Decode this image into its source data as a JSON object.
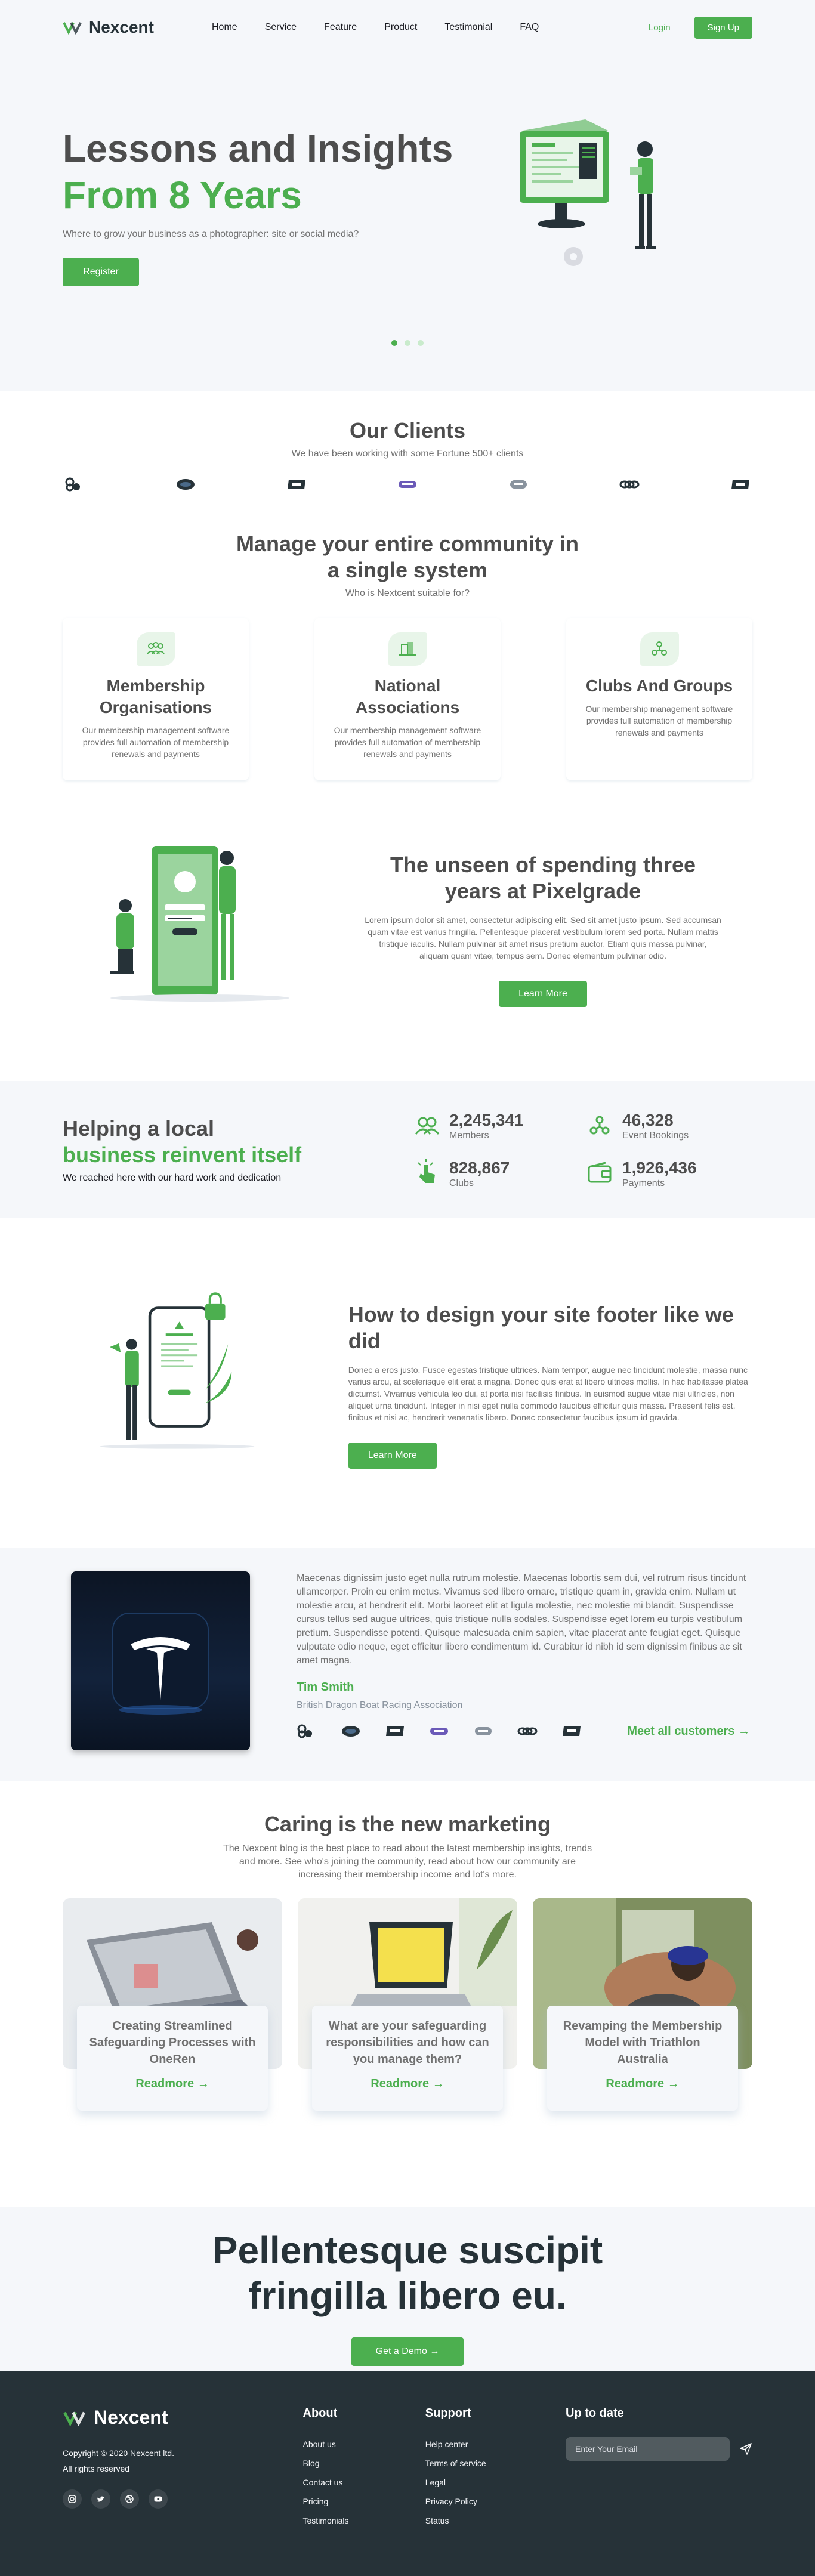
{
  "nav": {
    "brand": "Nexcent",
    "links": [
      "Home",
      "Service",
      "Feature",
      "Product",
      "Testimonial",
      "FAQ"
    ],
    "login": "Login",
    "signup": "Sign Up"
  },
  "hero": {
    "line1": "Lessons and Insights",
    "line2": "From 8 Years",
    "subtitle": "Where to grow your business as a photographer: site or social media?",
    "cta": "Register",
    "slides": 3,
    "active_slide": 1
  },
  "clients": {
    "title": "Our Clients",
    "subtitle": "We have been working with some Fortune 500+ clients",
    "logos": [
      "client-logo-1",
      "client-logo-2",
      "client-logo-3",
      "client-logo-4",
      "client-logo-5",
      "client-logo-6",
      "client-logo-7"
    ]
  },
  "community": {
    "title": "Manage your entire community in a single system",
    "subtitle": "Who is Nextcent suitable for?",
    "cards": [
      {
        "title": "Membership Organisations",
        "text": "Our membership management software provides full automation of membership renewals and payments",
        "icon": "members-icon"
      },
      {
        "title": "National Associations",
        "text": "Our membership management software provides full automation of membership renewals and payments",
        "icon": "building-icon"
      },
      {
        "title": "Clubs And Groups",
        "text": "Our membership management software provides full automation of membership renewals and payments",
        "icon": "hand-icon"
      }
    ]
  },
  "feature1": {
    "title": "The unseen of spending three years at Pixelgrade",
    "text": "Lorem ipsum dolor sit amet, consectetur adipiscing elit. Sed sit amet justo ipsum. Sed accumsan quam vitae est varius fringilla. Pellentesque placerat vestibulum lorem sed porta. Nullam mattis tristique iaculis. Nullam pulvinar sit amet risus pretium auctor. Etiam quis massa pulvinar, aliquam quam vitae, tempus sem. Donec elementum pulvinar odio.",
    "cta": "Learn More"
  },
  "stats": {
    "line1": "Helping a local",
    "line2": "business reinvent itself",
    "subtitle": "We reached here with our hard work and dedication",
    "items": [
      {
        "value": "2,245,341",
        "label": "Members",
        "icon": "members-icon"
      },
      {
        "value": "46,328",
        "label": "Event Bookings",
        "icon": "hands-icon"
      },
      {
        "value": "828,867",
        "label": "Clubs",
        "icon": "click-icon"
      },
      {
        "value": "1,926,436",
        "label": "Payments",
        "icon": "wallet-icon"
      }
    ]
  },
  "feature2": {
    "title": "How to design your site footer like we did",
    "text": "Donec a eros justo. Fusce egestas tristique ultrices. Nam tempor, augue nec tincidunt molestie, massa nunc varius arcu, at scelerisque elit erat a magna. Donec quis erat at libero ultrices mollis. In hac habitasse platea dictumst. Vivamus vehicula leo dui, at porta nisi facilisis finibus. In euismod augue vitae nisi ultricies, non aliquet urna tincidunt. Integer in nisi eget nulla commodo faucibus efficitur quis massa. Praesent felis est, finibus et nisi ac, hendrerit venenatis libero. Donec consectetur faucibus ipsum id gravida.",
    "cta": "Learn More"
  },
  "testimonial": {
    "quote": "Maecenas dignissim justo eget nulla rutrum molestie. Maecenas lobortis sem dui, vel rutrum risus tincidunt ullamcorper. Proin eu enim metus. Vivamus sed libero ornare, tristique quam in, gravida enim. Nullam ut molestie arcu, at hendrerit elit. Morbi laoreet elit at ligula molestie, nec molestie mi blandit. Suspendisse cursus tellus sed augue ultrices, quis tristique nulla sodales. Suspendisse eget lorem eu turpis vestibulum pretium. Suspendisse potenti. Quisque malesuada enim sapien, vitae placerat ante feugiat eget. Quisque vulputate odio neque, eget efficitur libero condimentum id. Curabitur id nibh id sem dignissim finibus ac sit amet magna.",
    "name": "Tim Smith",
    "org": "British Dragon Boat Racing Association",
    "more": "Meet all customers",
    "image_icon": "tesla-logo-icon"
  },
  "blog": {
    "title": "Caring is the new marketing",
    "subtitle": "The Nexcent blog is the best place to read about the latest membership insights, trends and more. See who's joining the community, read about how our community are increasing their membership income and lot's more.",
    "posts": [
      {
        "title": "Creating Streamlined Safeguarding Processes with OneRen",
        "link": "Readmore"
      },
      {
        "title": "What are your safeguarding responsibilities and how can you manage them?",
        "link": "Readmore"
      },
      {
        "title": "Revamping the Membership Model with Triathlon Australia",
        "link": "Readmore"
      }
    ]
  },
  "cta": {
    "title": "Pellentesque suscipit fringilla libero eu.",
    "button": "Get a Demo"
  },
  "footer": {
    "brand": "Nexcent",
    "copyright": "Copyright © 2020 Nexcent ltd.",
    "rights": "All rights reserved",
    "social": [
      "instagram-icon",
      "twitter-icon",
      "dribbble-icon",
      "youtube-icon"
    ],
    "about_title": "About",
    "about": [
      "About us",
      "Blog",
      "Contact us",
      "Pricing",
      "Testimonials"
    ],
    "support_title": "Support",
    "support": [
      "Help center",
      "Terms of service",
      "Legal",
      "Privacy Policy",
      "Status"
    ],
    "newsletter_title": "Up to date",
    "email_placeholder": "Enter Your Email"
  },
  "colors": {
    "primary": "#4caf4f",
    "dark": "#263238",
    "gray_bg": "#f5f7fa",
    "text": "#4d4d4d",
    "muted": "#717171"
  }
}
